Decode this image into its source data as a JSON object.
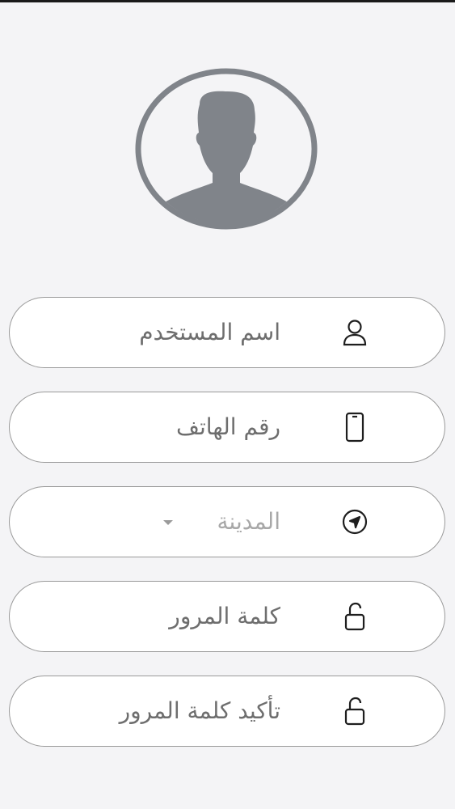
{
  "colors": {
    "background": "#f4f4f6",
    "avatar": "#80848a",
    "field_border": "#9a9a9a",
    "label_text": "#6e6e6e",
    "placeholder_text": "#a8a8a8",
    "icon_stroke": "#1e1e1e"
  },
  "form": {
    "fields": [
      {
        "label": "اسم المستخدم",
        "icon": "user-icon"
      },
      {
        "label": "رقم الهاتف",
        "icon": "phone-icon"
      },
      {
        "label": "المدينة",
        "icon": "navigation-icon",
        "type": "dropdown"
      },
      {
        "label": "كلمة المرور",
        "icon": "lock-open-icon"
      },
      {
        "label": "تأكيد كلمة المرور",
        "icon": "lock-open-icon"
      }
    ]
  }
}
